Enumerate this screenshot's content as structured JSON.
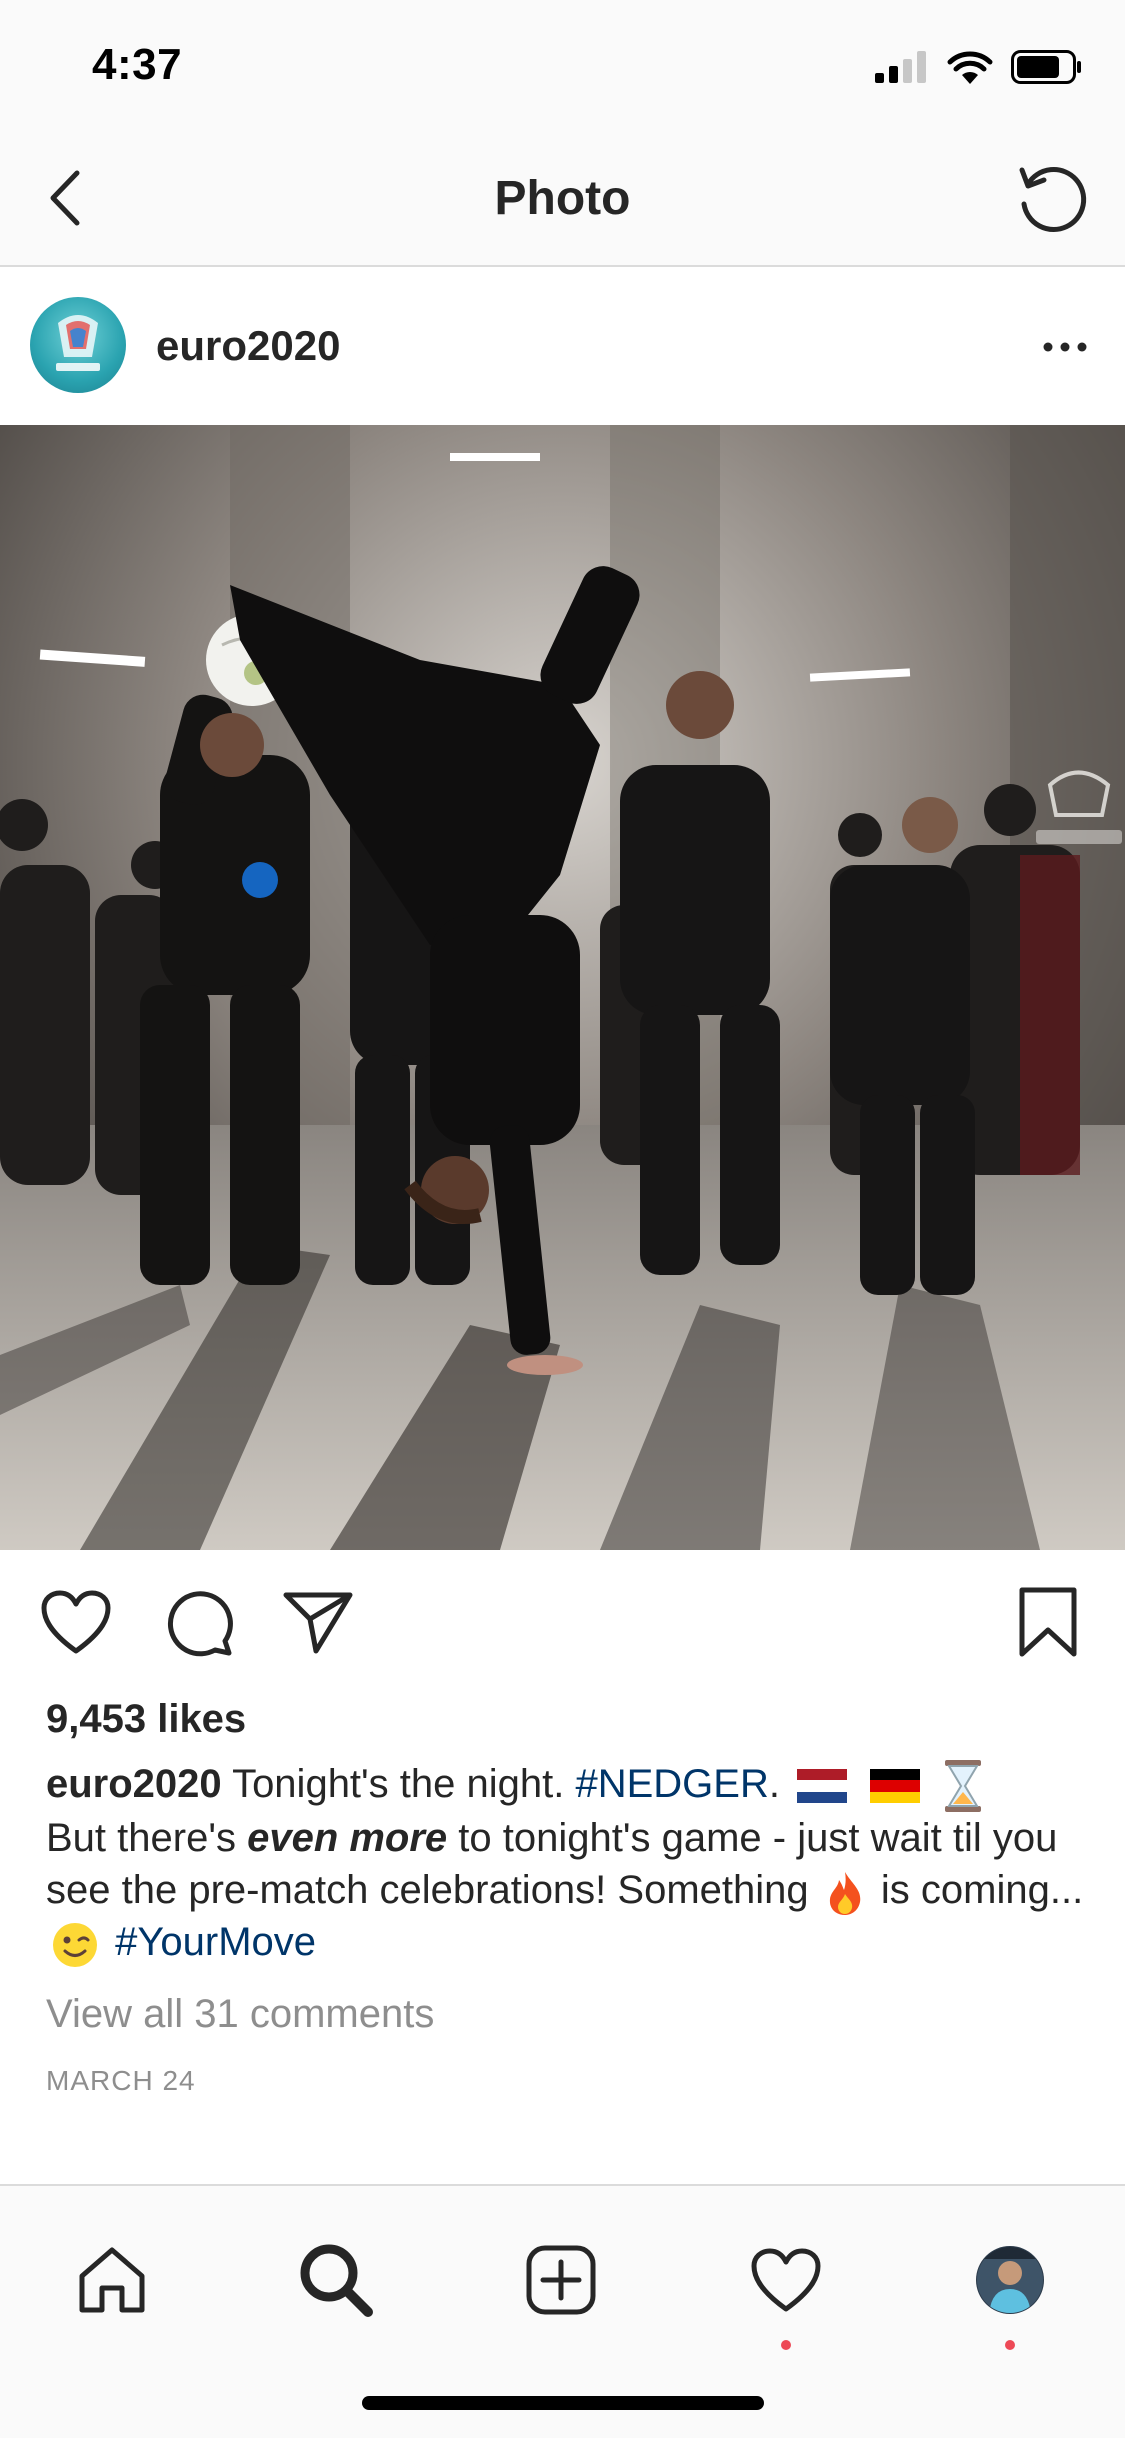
{
  "status_bar": {
    "time": "4:37"
  },
  "nav": {
    "title": "Photo"
  },
  "post": {
    "username": "euro2020",
    "likes": "9,453 likes",
    "caption": {
      "username": "euro2020",
      "part1": " Tonight's the night. ",
      "hashtag1": "#NEDGER",
      "part2": ".",
      "part3": "But there's ",
      "emphasis": "even more",
      "part4": " to tonight's game - just wait til you see the pre-match celebrations! Something",
      "part5": " is coming...",
      "hashtag2": "#YourMove"
    },
    "view_comments": "View all 31 comments",
    "date": "MARCH 24"
  },
  "icons": {
    "back": "chevron-left-icon",
    "refresh": "refresh-icon",
    "more": "more-horizontal-icon",
    "like": "heart-icon",
    "comment": "comment-icon",
    "share": "share-icon",
    "save": "bookmark-icon",
    "home": "home-icon",
    "search": "search-icon",
    "add": "add-post-icon",
    "activity": "heart-icon",
    "profile": "profile-avatar"
  },
  "colors": {
    "hashtag": "#003569",
    "secondary_text": "#8e8e8e",
    "notification_dot": "#ed4956"
  }
}
